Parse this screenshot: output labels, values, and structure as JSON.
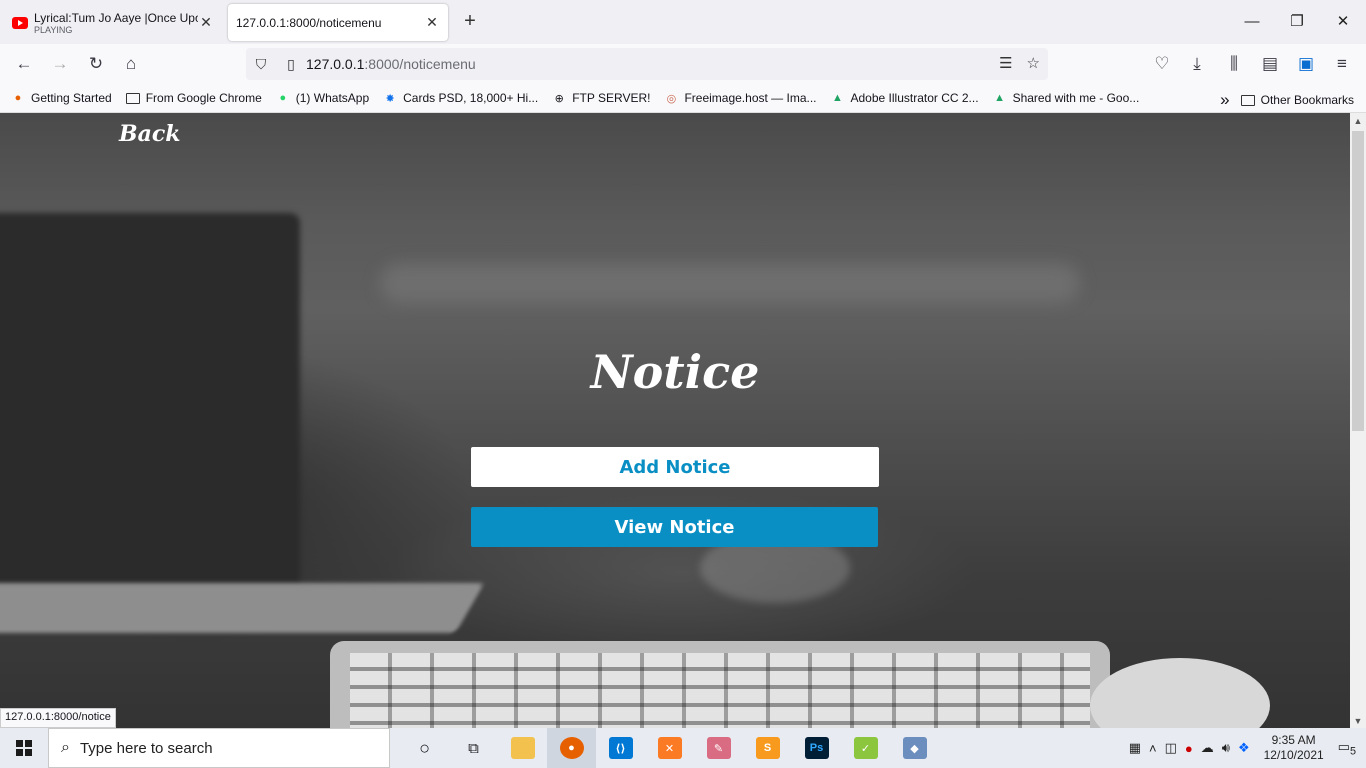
{
  "browser": {
    "tabs": [
      {
        "title": "Lyrical:Tum Jo Aaye |Once Upon",
        "subtitle": "PLAYING",
        "icon": "youtube-icon"
      },
      {
        "title": "127.0.0.1:8000/noticemenu",
        "icon": "none"
      }
    ],
    "new_tab_label": "+",
    "window_controls": {
      "minimize": "—",
      "maximize": "❐",
      "close": "✕"
    },
    "url": {
      "host": "127.0.0.1",
      "path": ":8000/noticemenu"
    },
    "bookmarks": [
      {
        "label": "Getting Started",
        "icon": "firefox-icon"
      },
      {
        "label": "From Google Chrome",
        "icon": "folder-icon"
      },
      {
        "label": "(1) WhatsApp",
        "icon": "whatsapp-icon"
      },
      {
        "label": "Cards PSD, 18,000+ Hi...",
        "icon": "freepik-icon"
      },
      {
        "label": "FTP SERVER!",
        "icon": "globe-icon"
      },
      {
        "label": "Freeimage.host — Ima...",
        "icon": "freeimage-icon"
      },
      {
        "label": "Adobe Illustrator CC 2...",
        "icon": "google-drive-icon"
      },
      {
        "label": "Shared with me - Goo...",
        "icon": "google-drive-icon"
      }
    ],
    "overflow_label": "»",
    "other_bookmarks": "Other Bookmarks",
    "status_url": "127.0.0.1:8000/notice"
  },
  "page": {
    "back_label": "Back",
    "title": "Notice",
    "add_button": "Add Notice",
    "view_button": "View Notice",
    "accent_color": "#0a8fc4"
  },
  "taskbar": {
    "search_placeholder": "Type here to search",
    "apps": [
      "cortana-icon",
      "task-view-icon",
      "file-explorer-icon",
      "firefox-icon",
      "vscode-icon",
      "xampp-icon",
      "paint-icon",
      "sublime-icon",
      "photoshop-icon",
      "notepad-icon",
      "git-icon"
    ],
    "time": "9:35 AM",
    "date": "12/10/2021",
    "notification_count": "5"
  }
}
